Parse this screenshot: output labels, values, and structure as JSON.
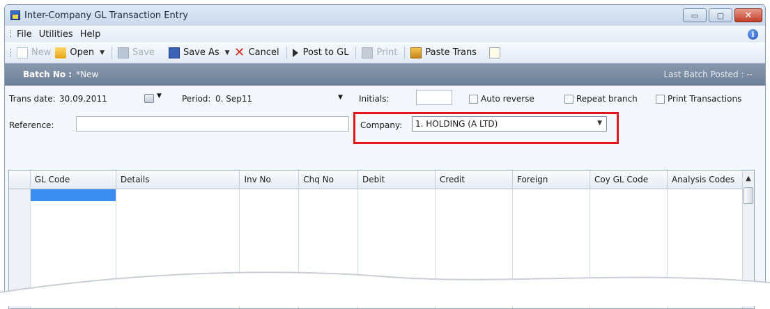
{
  "window": {
    "title": "Inter-Company GL Transaction Entry",
    "controls": {
      "minimize": "▭",
      "maximize": "▢",
      "close": "✕"
    }
  },
  "menu": {
    "items": [
      "File",
      "Utilities",
      "Help"
    ],
    "info_icon": "i"
  },
  "toolbar": {
    "new": "New",
    "open": "Open",
    "save": "Save",
    "save_as": "Save As",
    "cancel": "Cancel",
    "post_to_gl": "Post to GL",
    "print": "Print",
    "paste_trans": "Paste Trans"
  },
  "batch": {
    "label": "Batch No :",
    "value": "*New",
    "last_posted": "Last Batch Posted : --"
  },
  "form": {
    "trans_date_label": "Trans date:",
    "trans_date_value": "30.09.2011",
    "period_label": "Period:",
    "period_value": "0. Sep11",
    "initials_label": "Initials:",
    "initials_value": "",
    "auto_reverse": "Auto reverse",
    "repeat_branch": "Repeat branch",
    "print_transactions": "Print Transactions",
    "reference_label": "Reference:",
    "reference_value": "",
    "company_label": "Company:",
    "company_value": "1. HOLDING (A LTD)"
  },
  "grid": {
    "columns": [
      "GL Code",
      "Details",
      "Inv No",
      "Chq No",
      "Debit",
      "Credit",
      "Foreign",
      "Coy GL Code",
      "Analysis Codes"
    ]
  },
  "colors": {
    "highlight": "#e0161b",
    "selection": "#3b8ef0",
    "batch_bar": "#7a8ba2"
  }
}
